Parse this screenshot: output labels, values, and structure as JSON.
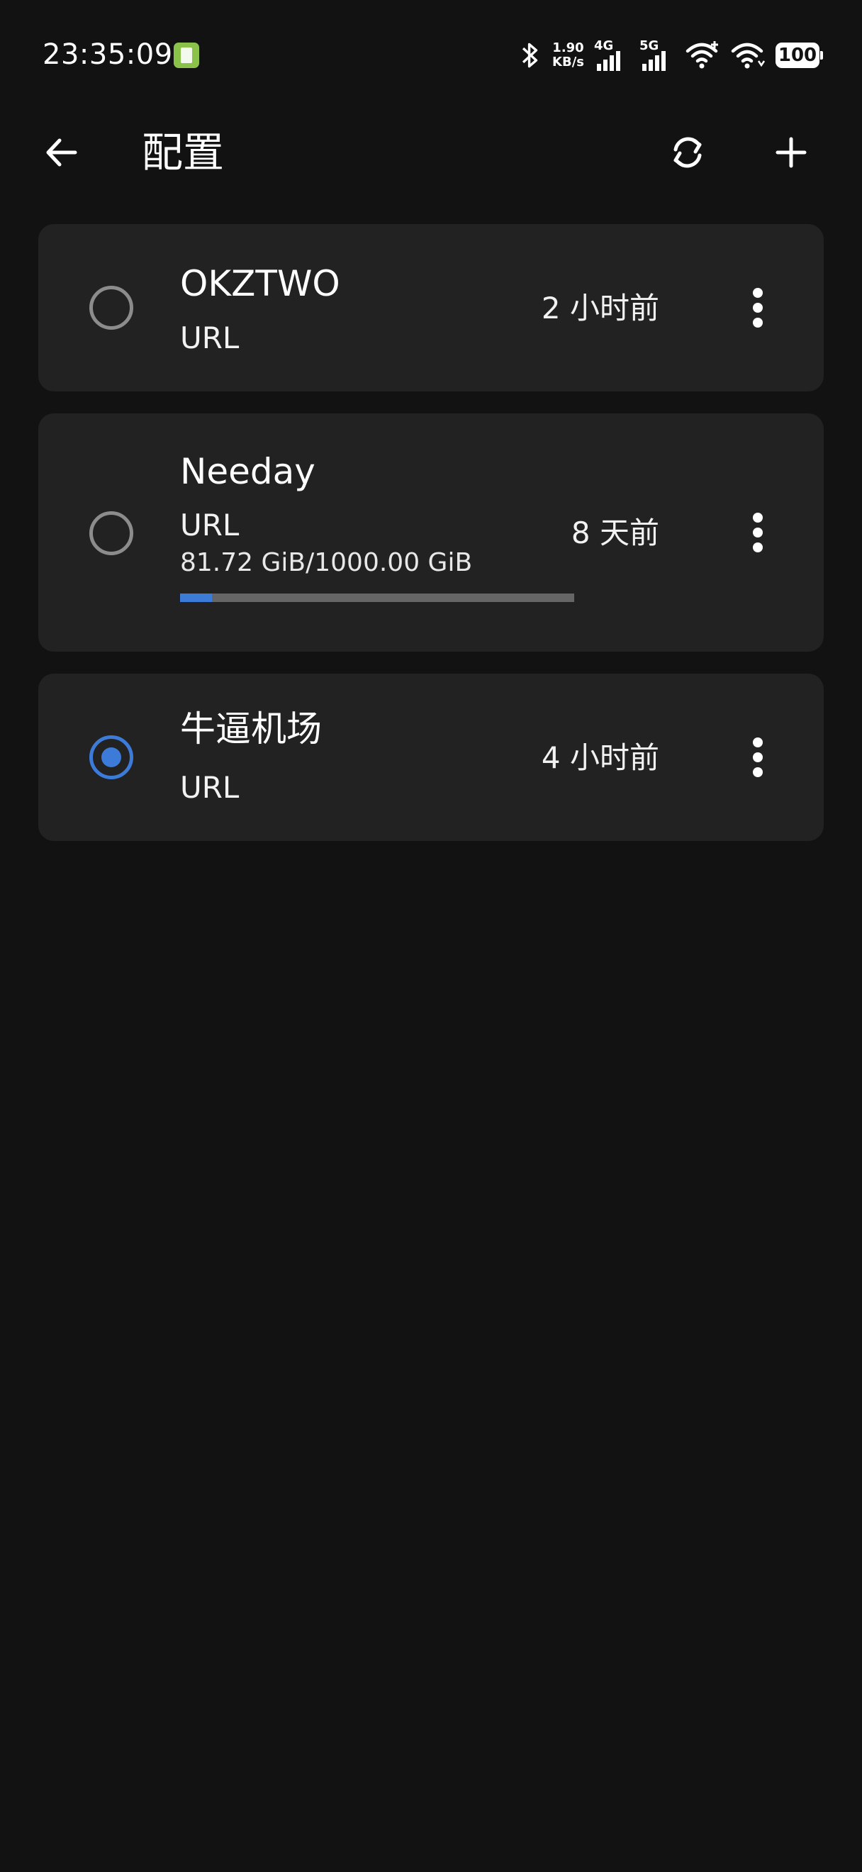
{
  "status_bar": {
    "time": "23:35:09",
    "net_speed_value": "1.90",
    "net_speed_unit": "KB/s",
    "sim1_label": "4G",
    "sim2_label": "5G",
    "battery": "100"
  },
  "header": {
    "title": "配置",
    "back_icon": "arrow-left-icon",
    "sync_icon": "sync-icon",
    "add_icon": "plus-icon"
  },
  "profiles": [
    {
      "name": "OKZTWO",
      "type": "URL",
      "updated": "2 小时前",
      "selected": false
    },
    {
      "name": "Needay",
      "type": "URL",
      "usage": "81.72 GiB/1000.00 GiB",
      "usage_fraction": 0.0817,
      "updated": "8 天前",
      "selected": false
    },
    {
      "name": "牛逼机场",
      "type": "URL",
      "updated": "4 小时前",
      "selected": true
    }
  ],
  "colors": {
    "background": "#121212",
    "card": "#222222",
    "accent": "#3d7bd9",
    "status_icon": "#8bc34a"
  }
}
